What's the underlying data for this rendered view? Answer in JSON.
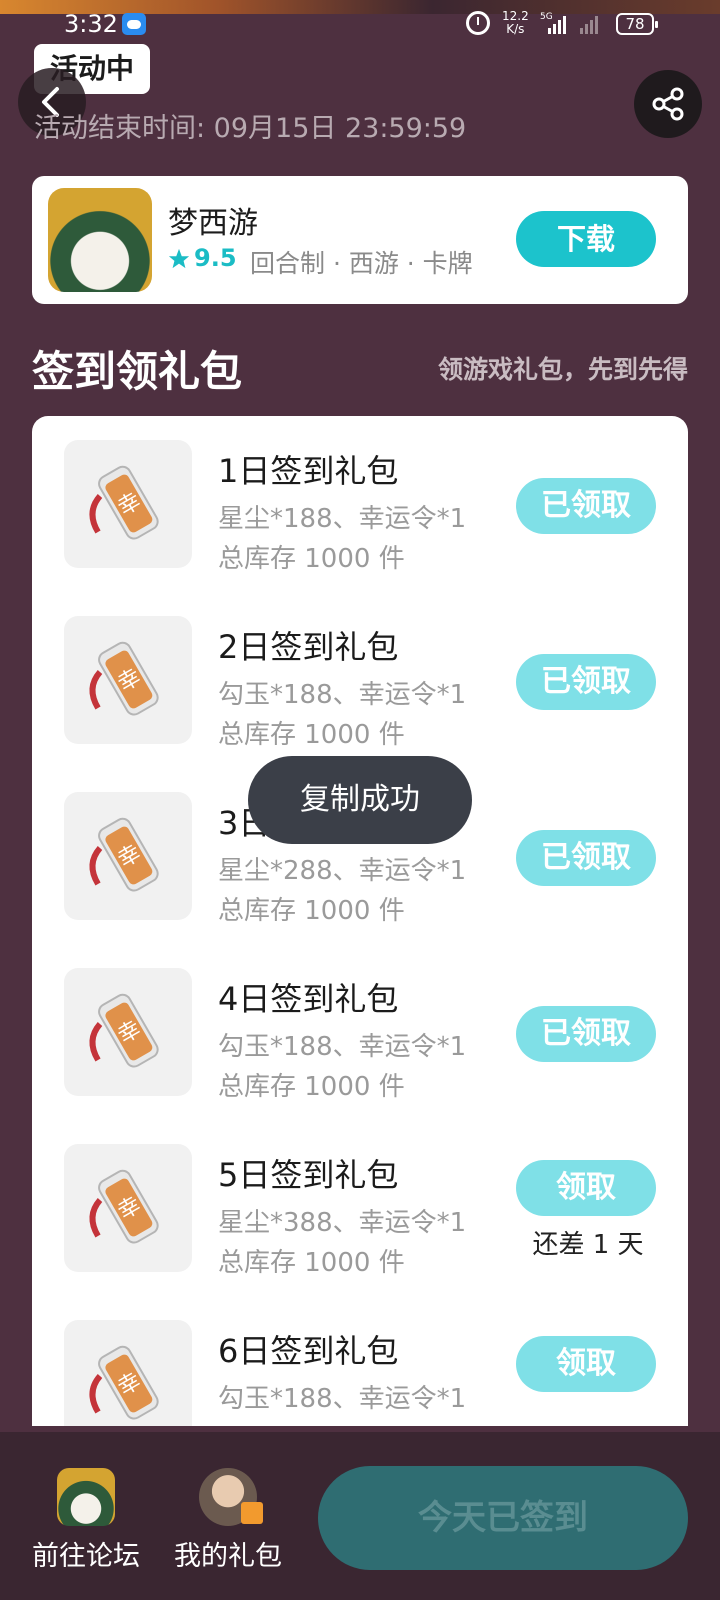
{
  "status_bar": {
    "time": "3:32",
    "speed_value": "12.2",
    "speed_unit": "K/s",
    "network": "5G",
    "battery": "78"
  },
  "header": {
    "badge": "活动中",
    "end_time": "活动结束时间: 09月15日 23:59:59"
  },
  "game": {
    "name": "梦西游",
    "rating": "9.5",
    "tags": "回合制 · 西游 · 卡牌",
    "download_label": "下载"
  },
  "section": {
    "title": "签到领礼包",
    "subtitle": "领游戏礼包，先到先得"
  },
  "gifts": [
    {
      "name": "1日签到礼包",
      "content": "星尘*188、幸运令*1",
      "stock": "总库存 1000 件",
      "button": "已领取",
      "note": ""
    },
    {
      "name": "2日签到礼包",
      "content": "勾玉*188、幸运令*1",
      "stock": "总库存 1000 件",
      "button": "已领取",
      "note": ""
    },
    {
      "name": "3日签到礼包",
      "content": "星尘*288、幸运令*1",
      "stock": "总库存 1000 件",
      "button": "已领取",
      "note": ""
    },
    {
      "name": "4日签到礼包",
      "content": "勾玉*188、幸运令*1",
      "stock": "总库存 1000 件",
      "button": "已领取",
      "note": ""
    },
    {
      "name": "5日签到礼包",
      "content": "星尘*388、幸运令*1",
      "stock": "总库存 1000 件",
      "button": "领取",
      "note": "还差 1 天"
    },
    {
      "name": "6日签到礼包",
      "content": "勾玉*188、幸运令*1",
      "stock": "",
      "button": "领取",
      "note": ""
    }
  ],
  "toast": "复制成功",
  "bottom": {
    "forum_label": "前往论坛",
    "my_gifts_label": "我的礼包",
    "signed_label": "今天已签到"
  },
  "colors": {
    "background": "#4e3040",
    "accent": "#1cc3cc",
    "claimed_button": "#7fe0e7",
    "bottom_bar": "#3a2631"
  },
  "icons": [
    "back-icon",
    "share-icon",
    "star-icon",
    "gift-tag-icon",
    "alarm-icon",
    "battery-icon",
    "signal-icon"
  ]
}
